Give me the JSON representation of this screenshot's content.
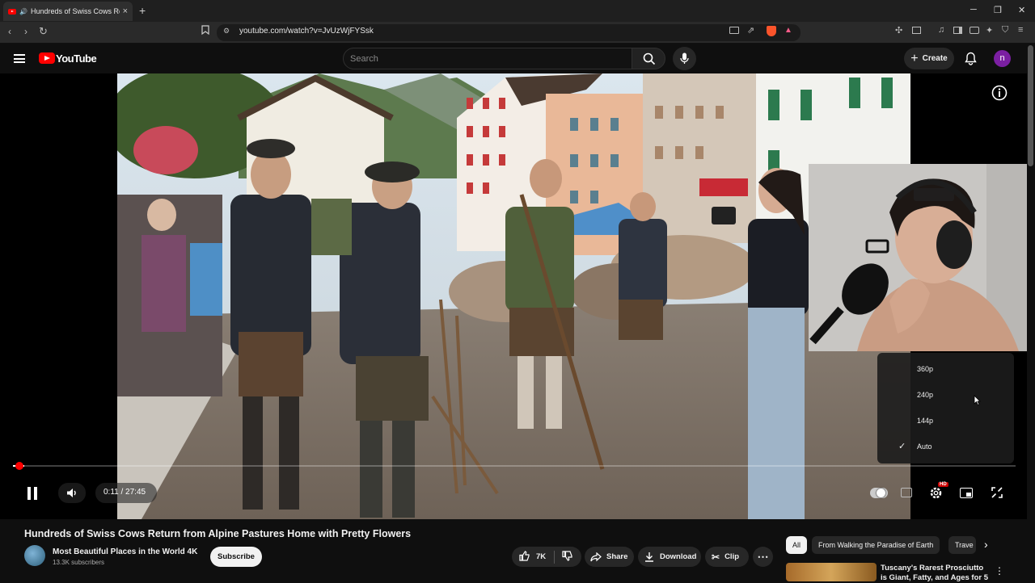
{
  "browser": {
    "tab_title": "Hundreds of Swiss Cows Retu",
    "url": "youtube.com/watch?v=JvUzWjFYSsk",
    "new_tab": "+",
    "close_tab": "×"
  },
  "header": {
    "logo_text": "YouTube",
    "search_placeholder": "Search",
    "create_label": "Create",
    "avatar_letter": "n"
  },
  "player": {
    "time": "0:11 / 27:45",
    "progress": 0.0066,
    "quality_options": [
      "360p",
      "240p",
      "144p",
      "Auto"
    ],
    "selected_quality": "Auto",
    "hd_badge": "HD"
  },
  "video": {
    "title": "Hundreds of Swiss Cows Return from Alpine Pastures Home with Pretty Flowers",
    "channel": "Most Beautiful Places in the World 4K",
    "subscribers": "13.3K subscribers",
    "subscribe_label": "Subscribe",
    "likes": "7K",
    "share_label": "Share",
    "download_label": "Download",
    "clip_label": "Clip"
  },
  "sidebar": {
    "chips": [
      "All",
      "From Walking the Paradise of Earth",
      "Trave"
    ],
    "rec_title": "Tuscany's Rarest Prosciutto is Giant, Fatty, and Ages for 5"
  },
  "colors": {
    "accent": "#ff0000",
    "bg": "#0f0f0f",
    "chip": "#272727"
  }
}
